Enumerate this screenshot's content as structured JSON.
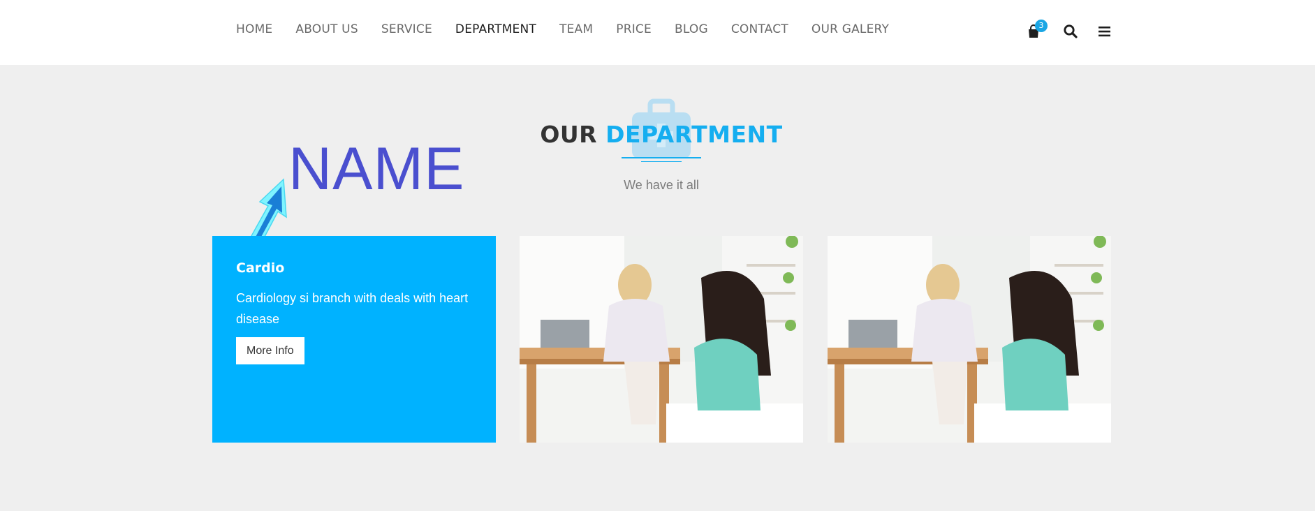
{
  "nav": {
    "items": [
      {
        "label": "HOME"
      },
      {
        "label": "ABOUT US"
      },
      {
        "label": "SERVICE"
      },
      {
        "label": "DEPARTMENT"
      },
      {
        "label": "TEAM"
      },
      {
        "label": "PRICE"
      },
      {
        "label": "BLOG"
      },
      {
        "label": "CONTACT"
      },
      {
        "label": "OUR GALERY"
      }
    ],
    "active": "DEPARTMENT",
    "cart_count": "3",
    "icons": [
      "shopping-bag-icon",
      "search-icon",
      "menu-icon"
    ]
  },
  "section": {
    "heading_plain": "OUR",
    "heading_accent": "DEPARTMENT",
    "subheading": "We have it all",
    "background_icon": "briefcase-medical-icon"
  },
  "annotation": {
    "text": "NAME",
    "arrow_color": "#7ff4ff"
  },
  "cards": [
    {
      "title": "Cardio",
      "description": "Cardiology si branch with deals with heart disease",
      "button": "More Info"
    }
  ],
  "colors": {
    "accent": "#00b2ff",
    "heading": "#333333",
    "section_bg": "#efefef",
    "annotation": "#4a4fcf"
  }
}
